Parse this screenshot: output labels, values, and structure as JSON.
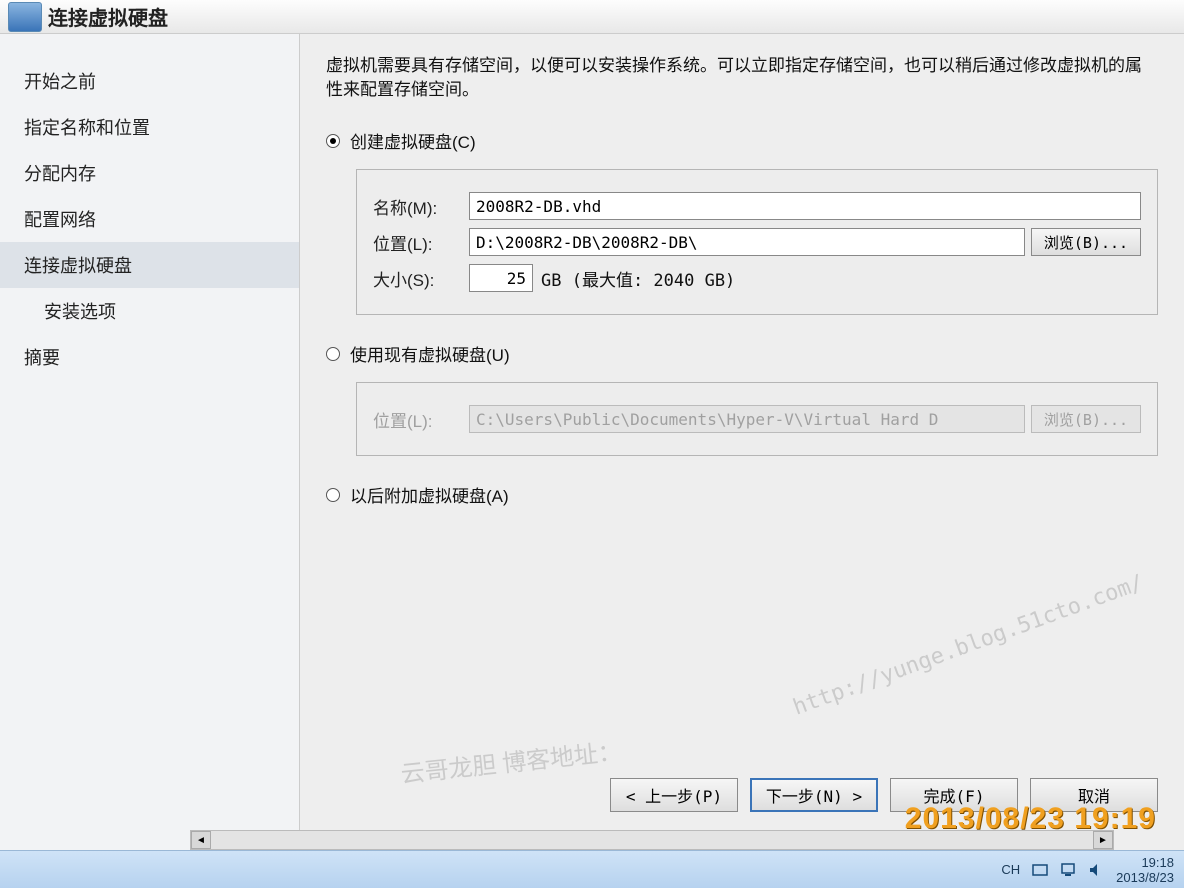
{
  "window": {
    "title": "连接虚拟硬盘"
  },
  "sidebar": {
    "items": [
      {
        "label": "开始之前"
      },
      {
        "label": "指定名称和位置"
      },
      {
        "label": "分配内存"
      },
      {
        "label": "配置网络"
      },
      {
        "label": "连接虚拟硬盘",
        "selected": true
      },
      {
        "label": "安装选项",
        "indent": true
      },
      {
        "label": "摘要"
      }
    ]
  },
  "main": {
    "description": "虚拟机需要具有存储空间，以便可以安装操作系统。可以立即指定存储空间，也可以稍后通过修改虚拟机的属性来配置存储空间。",
    "option_create": {
      "label": "创建虚拟硬盘(C)",
      "name_label": "名称(M):",
      "name_value": "2008R2-DB.vhd",
      "loc_label": "位置(L):",
      "loc_value": "D:\\2008R2-DB\\2008R2-DB\\",
      "browse": "浏览(B)...",
      "size_label": "大小(S):",
      "size_value": "25",
      "size_suffix": "GB (最大值: 2040 GB)"
    },
    "option_existing": {
      "label": "使用现有虚拟硬盘(U)",
      "loc_label": "位置(L):",
      "loc_value": "C:\\Users\\Public\\Documents\\Hyper-V\\Virtual Hard D",
      "browse": "浏览(B)..."
    },
    "option_later": {
      "label": "以后附加虚拟硬盘(A)"
    }
  },
  "buttons": {
    "prev": "< 上一步(P)",
    "next": "下一步(N) >",
    "finish": "完成(F)",
    "cancel": "取消"
  },
  "taskbar": {
    "lang": "CH",
    "time": "19:18",
    "date": "2013/8/23"
  },
  "watermark": {
    "text": "云哥龙胆 博客地址：",
    "url": "http://yunge.blog.51cto.com/"
  },
  "photo_timestamp": "2013/08/23 19:19"
}
